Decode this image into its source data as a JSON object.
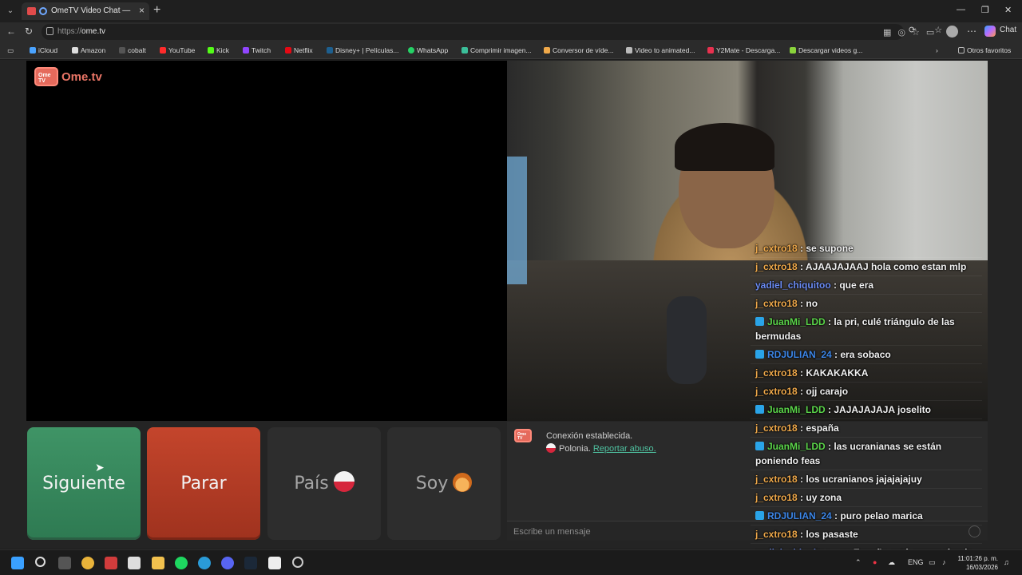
{
  "browser": {
    "tab_title": "OmeTV Video Chat — Omegle",
    "url_scheme": "https://",
    "url_host": "ome.tv",
    "chat_label": "Chat",
    "bookmarks": [
      "iCloud",
      "Amazon",
      "cobalt",
      "YouTube",
      "Kick",
      "Twitch",
      "Netflix",
      "Disney+ | Películas...",
      "WhatsApp",
      "Comprimir imagen...",
      "Conversor de víde...",
      "Video to animated...",
      "Y2Mate - Descarga...",
      "Descargar videos g..."
    ],
    "other_favorites": "Otros favoritos"
  },
  "logo": {
    "badge": "Ome TV",
    "text": "Ome.tv"
  },
  "buttons": {
    "next": "Siguiente",
    "stop": "Parar",
    "country": "País",
    "soy": "Soy"
  },
  "system": {
    "connected": "Conexión establecida.",
    "country": "Polonia.",
    "report": "Reportar abuso."
  },
  "input": {
    "placeholder": "Escribe un mensaje"
  },
  "chat_messages": [
    {
      "user": "j_cxtro18",
      "text": ": se supone",
      "color": "#f0a94a",
      "badge": false
    },
    {
      "user": "j_cxtro18",
      "text": ": AJAAJAJAAJ hola como estan mlp",
      "color": "#f0a94a",
      "badge": false
    },
    {
      "user": "yadiel_chiquitoo",
      "text": ": que era",
      "color": "#6b8cf5",
      "badge": false
    },
    {
      "user": "j_cxtro18",
      "text": ": no",
      "color": "#f0a94a",
      "badge": false
    },
    {
      "user": "JuanMi_LDD",
      "text": ": la pri, culé triángulo de las bermudas",
      "color": "#5bd54a",
      "badge": true
    },
    {
      "user": "RDJULIAN_24",
      "text": ": era sobaco",
      "color": "#3c86e8",
      "badge": true
    },
    {
      "user": "j_cxtro18",
      "text": ": KAKAKAKKA",
      "color": "#f0a94a",
      "badge": false
    },
    {
      "user": "j_cxtro18",
      "text": ": ojj carajo",
      "color": "#f0a94a",
      "badge": false
    },
    {
      "user": "JuanMi_LDD",
      "text": ": JAJAJAJAJA joselito",
      "color": "#5bd54a",
      "badge": true
    },
    {
      "user": "j_cxtro18",
      "text": ": españa",
      "color": "#f0a94a",
      "badge": false
    },
    {
      "user": "JuanMi_LDD",
      "text": ": las ucranianas se están poniendo feas",
      "color": "#5bd54a",
      "badge": true
    },
    {
      "user": "j_cxtro18",
      "text": ": los ucranianos jajajajajuy",
      "color": "#f0a94a",
      "badge": false
    },
    {
      "user": "j_cxtro18",
      "text": ": uy zona",
      "color": "#f0a94a",
      "badge": false
    },
    {
      "user": "RDJULIAN_24",
      "text": ": puro pelao marica",
      "color": "#3c86e8",
      "badge": true
    },
    {
      "user": "j_cxtro18",
      "text": ": los pasaste",
      "color": "#f0a94a",
      "badge": false
    },
    {
      "user": "yadiel_chiquitoo",
      "text": ": en España está amaneciendo",
      "color": "#6b8cf5",
      "badge": false
    }
  ],
  "taskbar": {
    "lang": "ENG",
    "time": "11:01:26 p. m.",
    "date": "16/03/2026"
  }
}
